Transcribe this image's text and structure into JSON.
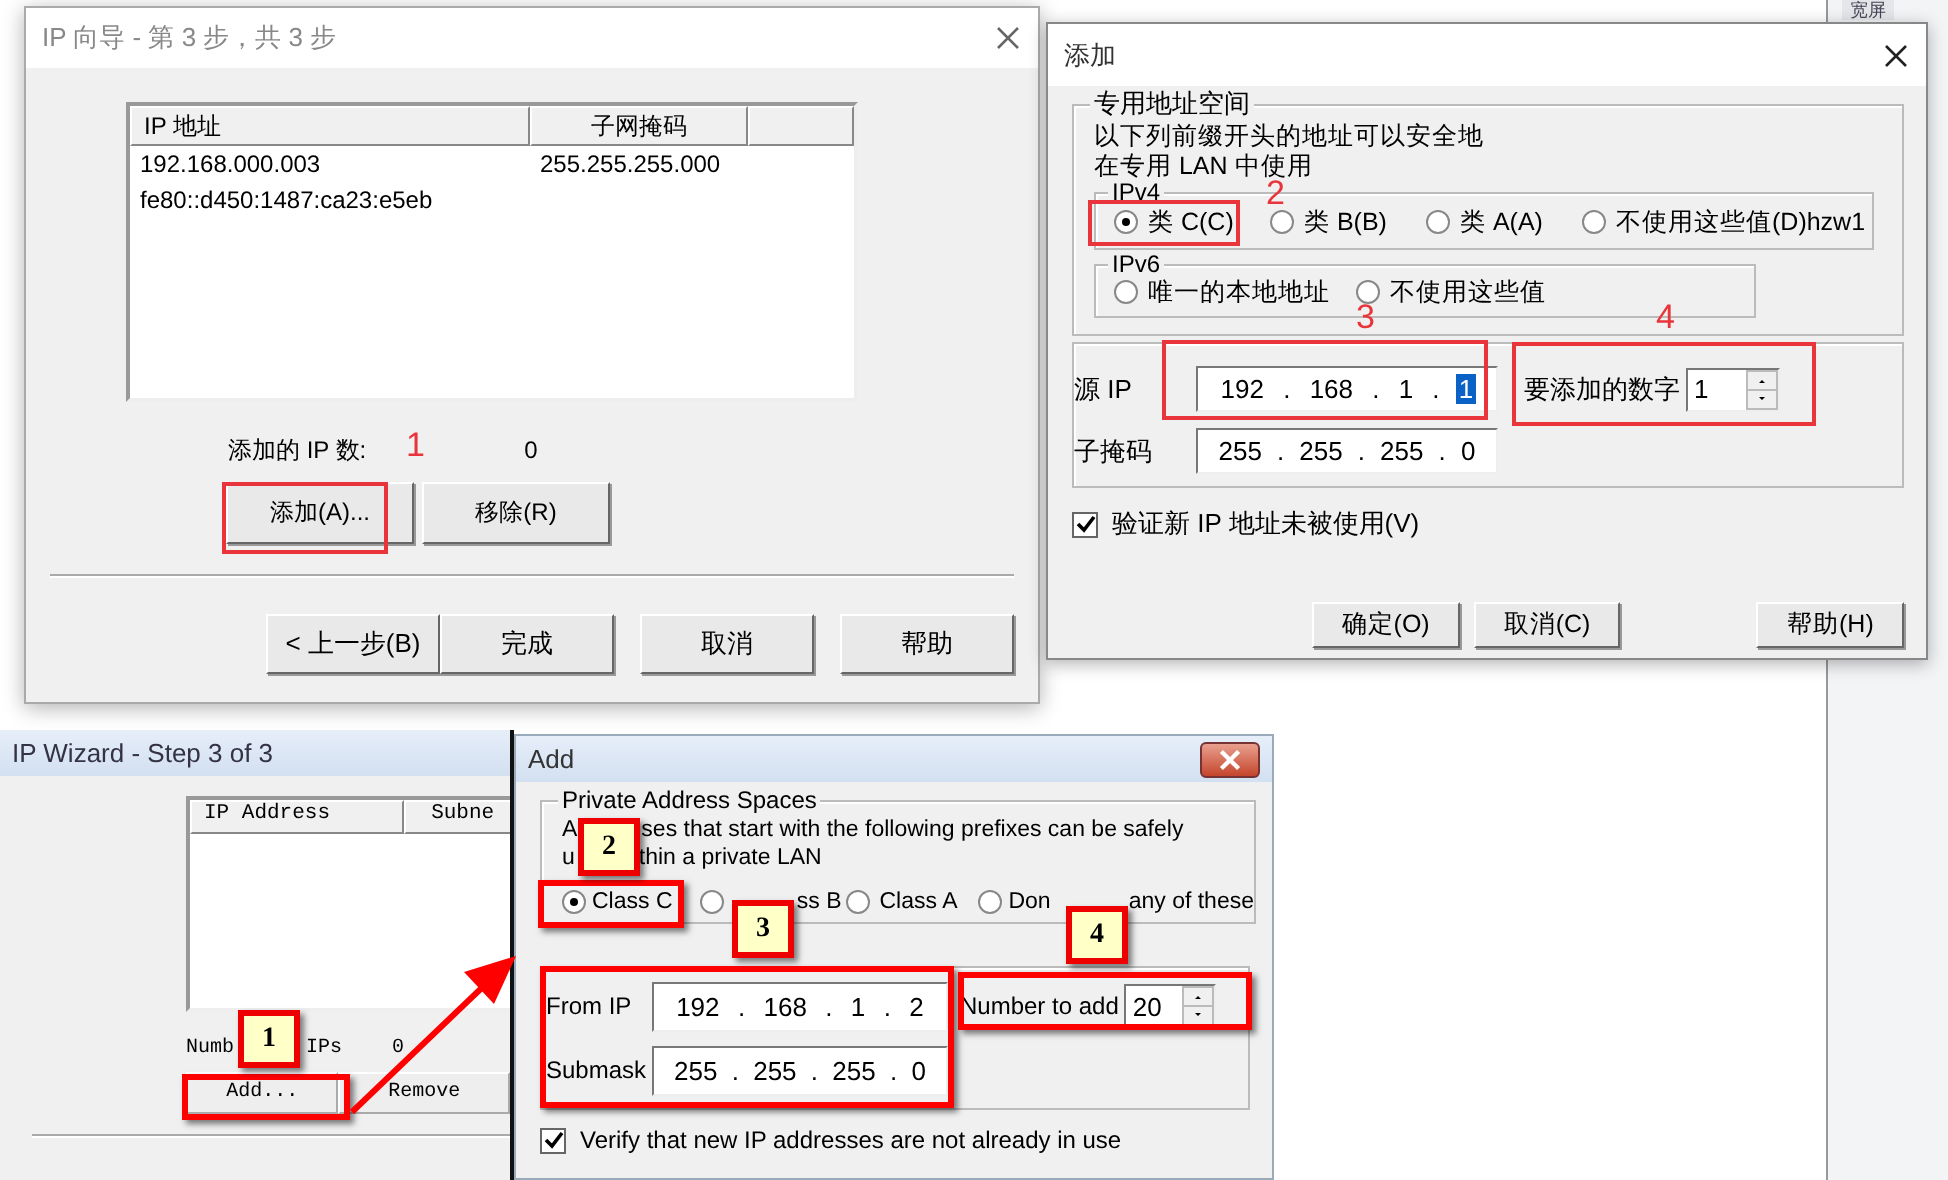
{
  "background": {
    "corner_tab": "宽屏"
  },
  "wizard_zh": {
    "title": "IP 向导 - 第 3 步，共 3 步",
    "columns": [
      "IP 地址",
      "子网掩码"
    ],
    "rows": [
      {
        "ip": "192.168.000.003",
        "mask": "255.255.255.000"
      },
      {
        "ip": "fe80::d450:1487:ca23:e5eb"
      }
    ],
    "count_label": "添加的 IP 数:",
    "count": "0",
    "list_buttons": [
      "添加(A)...",
      "移除(R)"
    ],
    "nav_buttons": [
      "< 上一步(B)",
      "完成",
      "取消",
      "帮助"
    ]
  },
  "add_zh": {
    "title": "添加",
    "group_title": "专用地址空间",
    "description": [
      "以下列前缀开头的地址可以安全地",
      "在专用 LAN 中使用"
    ],
    "ipv4_title": "IPv4",
    "ipv4_options": [
      {
        "label": "类 C(C)",
        "selected": true
      },
      {
        "label": "类 B(B)",
        "selected": false
      },
      {
        "label": "类 A(A)",
        "selected": false
      },
      {
        "label": "不使用这些值(D)hzw1",
        "selected": false
      }
    ],
    "ipv6_title": "IPv6",
    "ipv6_options": [
      {
        "label": "唯一的本地地址",
        "selected": false
      },
      {
        "label": "不使用这些值",
        "selected": false
      }
    ],
    "from_label": "源 IP",
    "from_ip": {
      "separator": ".",
      "octets": [
        {
          "value": "192",
          "selected": false
        },
        {
          "value": "168",
          "selected": false
        },
        {
          "value": "1",
          "selected": false
        },
        {
          "value": "1",
          "selected": true
        }
      ]
    },
    "number_label": "要添加的数字",
    "number": "1",
    "mask_label": "子掩码",
    "mask": {
      "separator": ".",
      "octets": [
        {
          "value": "255",
          "selected": false
        },
        {
          "value": "255",
          "selected": false
        },
        {
          "value": "255",
          "selected": false
        },
        {
          "value": "0",
          "selected": false
        }
      ]
    },
    "verify": {
      "label": "验证新 IP 地址未被使用(V)",
      "checked": true
    },
    "buttons": [
      "确定(O)",
      "取消(C)",
      "帮助(H)"
    ]
  },
  "wizard_en": {
    "title": "IP Wizard - Step 3 of 3",
    "columns": [
      "IP Address",
      "Subne"
    ],
    "count_label_parts": [
      "Numb",
      "IPs"
    ],
    "count": "0",
    "list_buttons": [
      "Add...",
      "Remove"
    ]
  },
  "add_en": {
    "title": "Add",
    "group_title": "Private Address Spaces",
    "description": [
      [
        "A",
        "ses that start with the following prefixes can be safely"
      ],
      [
        "u",
        "thin a private LAN"
      ]
    ],
    "options": [
      {
        "label_parts": [
          "Class C"
        ],
        "selected": true
      },
      {
        "label_parts": [
          "ss B"
        ],
        "selected": false
      },
      {
        "label_parts": [
          "Class A"
        ],
        "selected": false
      },
      {
        "label_parts": [
          "Don",
          "any of these"
        ],
        "selected": false
      }
    ],
    "from_label": "From IP",
    "from_ip": {
      "separator": ".",
      "octets": [
        {
          "value": "192",
          "selected": false
        },
        {
          "value": "168",
          "selected": false
        },
        {
          "value": "1",
          "selected": false
        },
        {
          "value": "2",
          "selected": false
        }
      ]
    },
    "number_label": "Number to add",
    "number": "20",
    "mask_label": "Submask",
    "mask": {
      "separator": ".",
      "octets": [
        {
          "value": "255",
          "selected": false
        },
        {
          "value": "255",
          "selected": false
        },
        {
          "value": "255",
          "selected": false
        },
        {
          "value": "0",
          "selected": false
        }
      ]
    },
    "verify": {
      "label": "Verify that new IP addresses are not already in use",
      "checked": true
    }
  },
  "annotations": [
    {
      "kind": "number",
      "label": "1"
    },
    {
      "kind": "number",
      "label": "2"
    },
    {
      "kind": "number",
      "label": "3"
    },
    {
      "kind": "number",
      "label": "4"
    },
    {
      "kind": "callout",
      "label": "1"
    },
    {
      "kind": "callout",
      "label": "2"
    },
    {
      "kind": "callout",
      "label": "3"
    },
    {
      "kind": "callout",
      "label": "4"
    }
  ]
}
